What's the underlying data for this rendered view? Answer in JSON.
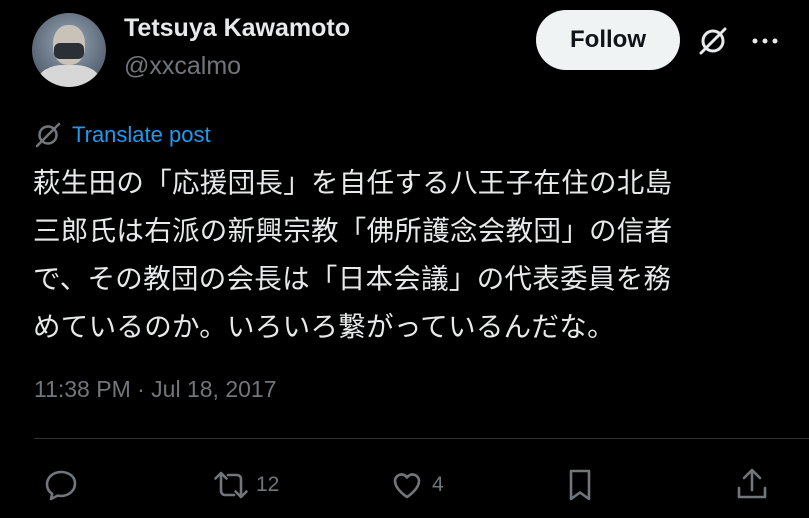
{
  "user": {
    "name": "Tetsuya Kawamoto",
    "handle": "@xxcalmo"
  },
  "header": {
    "follow_label": "Follow"
  },
  "translate": {
    "label": "Translate post"
  },
  "tweet": {
    "text": "萩生田の「応援団長」を自任する八王子在住の北島\n三郎氏は右派の新興宗教「佛所護念会教団」の信者\nで、その教団の会長は「日本会議」の代表委員を務\nめているのか。いろいろ繋がっているんだな。",
    "timestamp": "11:38 PM · Jul 18, 2017"
  },
  "actions": {
    "reply_count": "",
    "retweet_count": "12",
    "like_count": "4"
  },
  "icons": {
    "grok": "grok-icon",
    "more": "more-icon",
    "translate": "translate-icon",
    "reply": "reply-icon",
    "retweet": "retweet-icon",
    "like": "heart-icon",
    "bookmark": "bookmark-icon",
    "share": "share-icon"
  },
  "colors": {
    "background": "#000000",
    "text": "#e7e9ea",
    "secondary": "#71767b",
    "link": "#1d9bf0",
    "follow_bg": "#eff3f4"
  }
}
